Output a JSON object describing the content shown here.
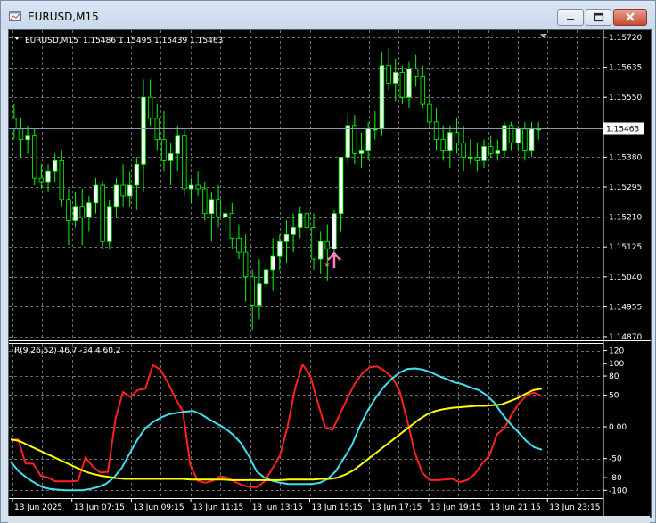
{
  "window": {
    "title": "EURUSD,M15"
  },
  "chart_header": {
    "symbol": "EURUSD,M15",
    "ohlc": "1.15486 1.15495 1.15439 1.15463"
  },
  "price_axis": {
    "ticks": [
      "1.15720",
      "1.15635",
      "1.15550",
      "1.15463",
      "1.15380",
      "1.15295",
      "1.15210",
      "1.15125",
      "1.15040",
      "1.14955",
      "1.14870"
    ],
    "current_price": "1.15463"
  },
  "indicator": {
    "label": "R(9,26,52) 46.7 -34.4 60.2",
    "ticks": [
      "120",
      "100",
      "80",
      "50",
      "0.00",
      "-50",
      "-80",
      "-100"
    ]
  },
  "time_axis": {
    "labels": [
      "13 Jun 2025",
      "13 Jun 07:15",
      "13 Jun 09:15",
      "13 Jun 11:15",
      "13 Jun 13:15",
      "13 Jun 15:15",
      "13 Jun 17:15",
      "13 Jun 19:15",
      "13 Jun 21:15",
      "13 Jun 23:15"
    ]
  },
  "colors": {
    "background": "#000000",
    "grid": "#6b6b6b",
    "bull_candle": "#ffffff",
    "bear_candle": "#000000",
    "wick": "#00ff00",
    "line_fast": "#ff2020",
    "line_mid": "#40e0f0",
    "line_slow": "#ffff00",
    "signal_arrow": "#ff80c0",
    "bid_line": "#8a9bb0"
  },
  "chart_data": [
    {
      "type": "candlestick",
      "title": "EURUSD,M15",
      "ylim": [
        1.1487,
        1.1572
      ],
      "candles": [
        [
          1.1549,
          1.1553,
          1.1543,
          1.1546
        ],
        [
          1.1546,
          1.1549,
          1.1538,
          1.1543
        ],
        [
          1.1543,
          1.1547,
          1.1539,
          1.1544
        ],
        [
          1.1544,
          1.1546,
          1.153,
          1.1532
        ],
        [
          1.1532,
          1.1536,
          1.1529,
          1.1531
        ],
        [
          1.1531,
          1.1536,
          1.1528,
          1.1534
        ],
        [
          1.1534,
          1.1539,
          1.1531,
          1.1537
        ],
        [
          1.1537,
          1.154,
          1.1524,
          1.1526
        ],
        [
          1.1526,
          1.1529,
          1.1513,
          1.152
        ],
        [
          1.152,
          1.1528,
          1.1518,
          1.1524
        ],
        [
          1.1524,
          1.1529,
          1.1513,
          1.1521
        ],
        [
          1.1521,
          1.1527,
          1.1517,
          1.1525
        ],
        [
          1.1525,
          1.1532,
          1.1522,
          1.153
        ],
        [
          1.153,
          1.1531,
          1.1512,
          1.1514
        ],
        [
          1.1514,
          1.1526,
          1.1512,
          1.1524
        ],
        [
          1.1524,
          1.1532,
          1.1521,
          1.153
        ],
        [
          1.153,
          1.1536,
          1.1524,
          1.1527
        ],
        [
          1.1527,
          1.1534,
          1.1524,
          1.153
        ],
        [
          1.153,
          1.1538,
          1.1523,
          1.1536
        ],
        [
          1.1536,
          1.156,
          1.1528,
          1.1555
        ],
        [
          1.1555,
          1.156,
          1.1547,
          1.1549
        ],
        [
          1.1549,
          1.1553,
          1.154,
          1.1543
        ],
        [
          1.1543,
          1.1551,
          1.1534,
          1.1537
        ],
        [
          1.1537,
          1.1542,
          1.153,
          1.1539
        ],
        [
          1.1539,
          1.1547,
          1.1534,
          1.1544
        ],
        [
          1.1544,
          1.1546,
          1.1527,
          1.1529
        ],
        [
          1.1529,
          1.1532,
          1.1525,
          1.153
        ],
        [
          1.153,
          1.1534,
          1.1527,
          1.1529
        ],
        [
          1.1529,
          1.1531,
          1.152,
          1.1522
        ],
        [
          1.1522,
          1.1528,
          1.1514,
          1.1526
        ],
        [
          1.1526,
          1.153,
          1.1518,
          1.1521
        ],
        [
          1.1521,
          1.1524,
          1.1517,
          1.1522
        ],
        [
          1.1522,
          1.1525,
          1.1512,
          1.1515
        ],
        [
          1.1515,
          1.1519,
          1.1509,
          1.1511
        ],
        [
          1.1511,
          1.1516,
          1.1497,
          1.1504
        ],
        [
          1.1504,
          1.1506,
          1.1489,
          1.1496
        ],
        [
          1.1496,
          1.1509,
          1.1492,
          1.1502
        ],
        [
          1.1502,
          1.151,
          1.15,
          1.1506
        ],
        [
          1.1506,
          1.1515,
          1.15,
          1.151
        ],
        [
          1.151,
          1.1516,
          1.1506,
          1.1514
        ],
        [
          1.1514,
          1.152,
          1.1508,
          1.1516
        ],
        [
          1.1516,
          1.1522,
          1.1511,
          1.1518
        ],
        [
          1.1518,
          1.1524,
          1.1515,
          1.1522
        ],
        [
          1.1522,
          1.1526,
          1.151,
          1.1518
        ],
        [
          1.1518,
          1.1522,
          1.1506,
          1.1509
        ],
        [
          1.1509,
          1.1517,
          1.1505,
          1.1514
        ],
        [
          1.1514,
          1.1519,
          1.1503,
          1.1512
        ],
        [
          1.1512,
          1.1523,
          1.1508,
          1.1522
        ],
        [
          1.1522,
          1.1536,
          1.1517,
          1.1538
        ],
        [
          1.1538,
          1.155,
          1.1536,
          1.1547
        ],
        [
          1.1547,
          1.155,
          1.1536,
          1.1539
        ],
        [
          1.1539,
          1.1545,
          1.1535,
          1.154
        ],
        [
          1.154,
          1.1548,
          1.1537,
          1.1546
        ],
        [
          1.1546,
          1.1551,
          1.1543,
          1.1546
        ],
        [
          1.1546,
          1.1568,
          1.1544,
          1.1564
        ],
        [
          1.1564,
          1.1569,
          1.1557,
          1.1559
        ],
        [
          1.1559,
          1.1566,
          1.1554,
          1.1562
        ],
        [
          1.1562,
          1.1564,
          1.1553,
          1.1555
        ],
        [
          1.1555,
          1.1565,
          1.1552,
          1.1563
        ],
        [
          1.1563,
          1.1567,
          1.1558,
          1.1561
        ],
        [
          1.1561,
          1.1564,
          1.1552,
          1.1553
        ],
        [
          1.1553,
          1.1556,
          1.1546,
          1.1548
        ],
        [
          1.1548,
          1.1552,
          1.154,
          1.1543
        ],
        [
          1.1543,
          1.1547,
          1.1537,
          1.154
        ],
        [
          1.154,
          1.1547,
          1.1535,
          1.1545
        ],
        [
          1.1545,
          1.1549,
          1.1539,
          1.1542
        ],
        [
          1.1542,
          1.1547,
          1.1534,
          1.1538
        ],
        [
          1.1538,
          1.1543,
          1.1536,
          1.1538
        ],
        [
          1.1538,
          1.1542,
          1.1534,
          1.1537
        ],
        [
          1.1537,
          1.1543,
          1.1535,
          1.1541
        ],
        [
          1.1541,
          1.1544,
          1.1538,
          1.1539
        ],
        [
          1.1539,
          1.1543,
          1.1537,
          1.154
        ],
        [
          1.154,
          1.1548,
          1.1538,
          1.1547
        ],
        [
          1.1547,
          1.1548,
          1.154,
          1.1542
        ],
        [
          1.1542,
          1.1547,
          1.154,
          1.1546
        ],
        [
          1.1546,
          1.1548,
          1.1537,
          1.154
        ],
        [
          1.154,
          1.1548,
          1.1538,
          1.1546
        ],
        [
          1.1546,
          1.1548,
          1.1543,
          1.1546
        ]
      ],
      "bid": 1.15463,
      "signal": {
        "kind": "buy-arrow",
        "bar_index": 47,
        "price": 1.151
      }
    },
    {
      "type": "line",
      "title": "R(9,26,52) 46.7 -34.4 60.2",
      "ylim": [
        -108,
        125
      ],
      "y_ticks": [
        120,
        100,
        80,
        50,
        0,
        -50,
        -80,
        -100
      ],
      "series": [
        {
          "values": [
            -20,
            -20,
            -58,
            -58,
            -77,
            -80,
            -86,
            -86,
            -86,
            -85,
            -48,
            -63,
            -72,
            -71,
            12,
            55,
            47,
            58,
            60,
            97,
            90,
            70,
            45,
            25,
            -60,
            -85,
            -88,
            -85,
            -78,
            -80,
            -87,
            -92,
            -95,
            -95,
            -85,
            -65,
            -45,
            0,
            60,
            98,
            82,
            40,
            0,
            -5,
            20,
            45,
            68,
            84,
            94,
            95,
            88,
            78,
            56,
            10,
            -40,
            -72,
            -84,
            -84,
            -83,
            -82,
            -87,
            -84,
            -75,
            -58,
            -45,
            -12,
            -2,
            20,
            38,
            50,
            54,
            48
          ]
        },
        {
          "values": [
            -55,
            -70,
            -80,
            -88,
            -95,
            -98,
            -99,
            -100,
            -100,
            -100,
            -98,
            -95,
            -90,
            -80,
            -65,
            -42,
            -20,
            -2,
            8,
            15,
            20,
            22,
            24,
            25,
            20,
            12,
            5,
            -2,
            -12,
            -25,
            -45,
            -70,
            -80,
            -85,
            -88,
            -90,
            -90,
            -90,
            -90,
            -88,
            -82,
            -70,
            -50,
            -30,
            0,
            25,
            45,
            62,
            75,
            85,
            91,
            92,
            90,
            86,
            80,
            75,
            70,
            67,
            62,
            58,
            50,
            38,
            20,
            5,
            -8,
            -22,
            -32,
            -36
          ]
        },
        {
          "values": [
            -20,
            -22,
            -28,
            -34,
            -40,
            -46,
            -52,
            -58,
            -64,
            -70,
            -74,
            -77,
            -79,
            -81,
            -82,
            -82,
            -82,
            -82,
            -82,
            -82,
            -82,
            -82,
            -83,
            -83,
            -83,
            -83,
            -83,
            -84,
            -84,
            -84,
            -84,
            -84,
            -84,
            -84,
            -83,
            -83,
            -83,
            -83,
            -82,
            -82,
            -80,
            -75,
            -68,
            -58,
            -48,
            -38,
            -28,
            -18,
            -8,
            2,
            12,
            20,
            25,
            28,
            30,
            31,
            32,
            33,
            33,
            34,
            35,
            40,
            45,
            52,
            58,
            60
          ]
        }
      ]
    }
  ]
}
